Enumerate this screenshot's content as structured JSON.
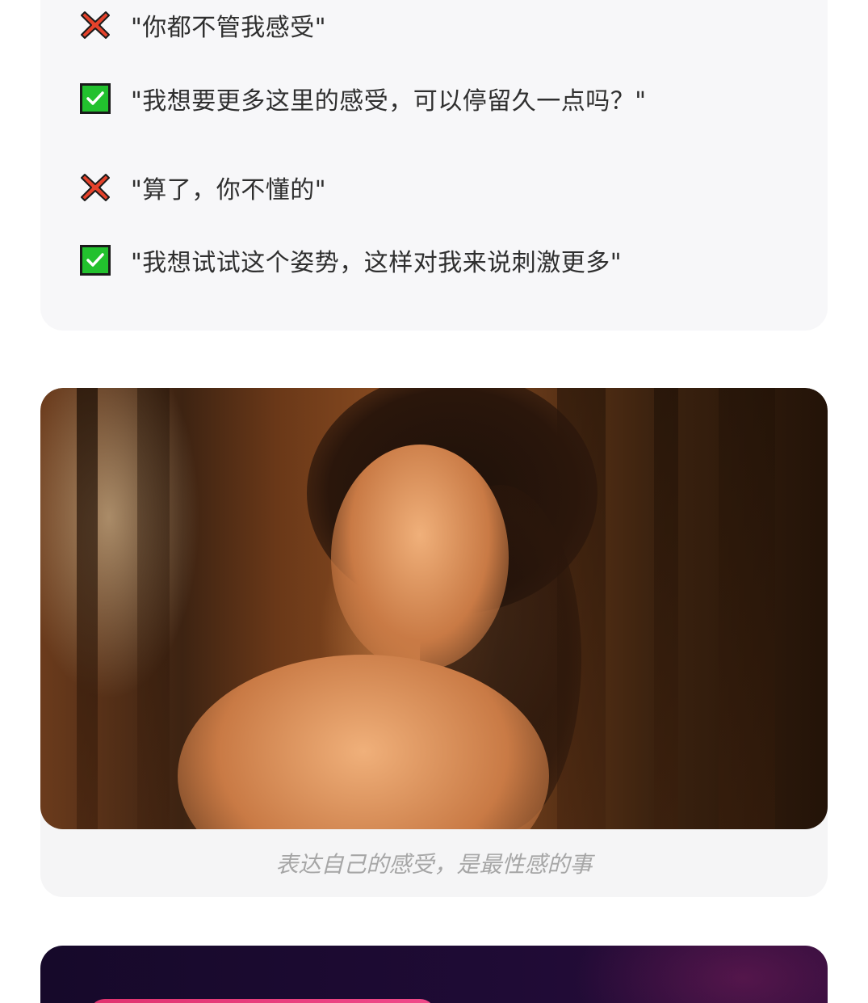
{
  "tips": [
    {
      "type": "wrong",
      "icon": "cross-mark-icon",
      "text": "\"你都不管我感受\""
    },
    {
      "type": "right",
      "icon": "check-box-icon",
      "text": "\"我想要更多这里的感受，可以停留久一点吗？\""
    },
    {
      "type": "wrong",
      "icon": "cross-mark-icon",
      "text": "\"算了，你不懂的\""
    },
    {
      "type": "right",
      "icon": "check-box-icon",
      "text": "\"我想试试这个姿势，这样对我来说刺激更多\""
    }
  ],
  "image_card": {
    "caption": "表达自己的感受，是最性感的事"
  },
  "colors": {
    "cross": "#e5422b",
    "check_fill": "#22c12e",
    "check_border": "#1a1a1a",
    "promo_bg": "#1a0a2e",
    "promo_accent": "#e8387c"
  }
}
